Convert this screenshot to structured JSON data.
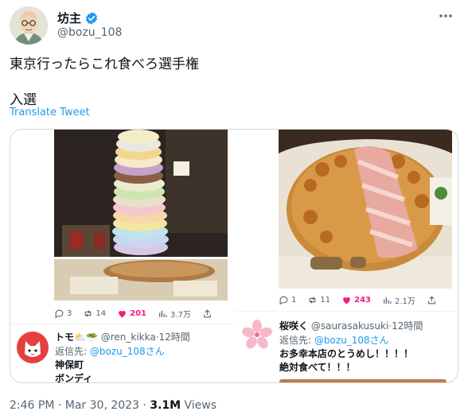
{
  "author": {
    "name": "坊主",
    "handle": "@bozu_108"
  },
  "tweet": {
    "line1": "東京行ったらこれ食べろ選手権",
    "line2": "入選",
    "translate_label": "Translate Tweet"
  },
  "left_card": {
    "actions": {
      "reply": "3",
      "retweet": "14",
      "like": "201",
      "views": "3.7万"
    },
    "reply": {
      "name": "トモ",
      "name_emoji": "⛅🥗",
      "handle": "@ren_kikka",
      "time": "·12時間",
      "to_prefix": "返信先:",
      "to_handle": "@bozu_108さん",
      "body1": "神保町",
      "body2": "ボンディ"
    }
  },
  "right_card": {
    "actions": {
      "reply": "1",
      "retweet": "11",
      "like": "243",
      "views": "2.1万"
    },
    "reply": {
      "name": "桜咲く",
      "handle": "@saurasakusuki",
      "time": "·12時間",
      "to_prefix": "返信先:",
      "to_handle": "@bozu_108さん",
      "body1": "お多幸本店のとうめし！！！！",
      "body2": "絶対食べて！！！"
    }
  },
  "footer": {
    "time": "2:46 PM · Mar 30, 2023 · ",
    "views_count": "3.1M",
    "views_label": " Views"
  },
  "colors": {
    "accent": "#1d9bf0",
    "like": "#f91880",
    "text": "#0f1419",
    "secondary": "#536471",
    "border": "#cfd9de"
  }
}
